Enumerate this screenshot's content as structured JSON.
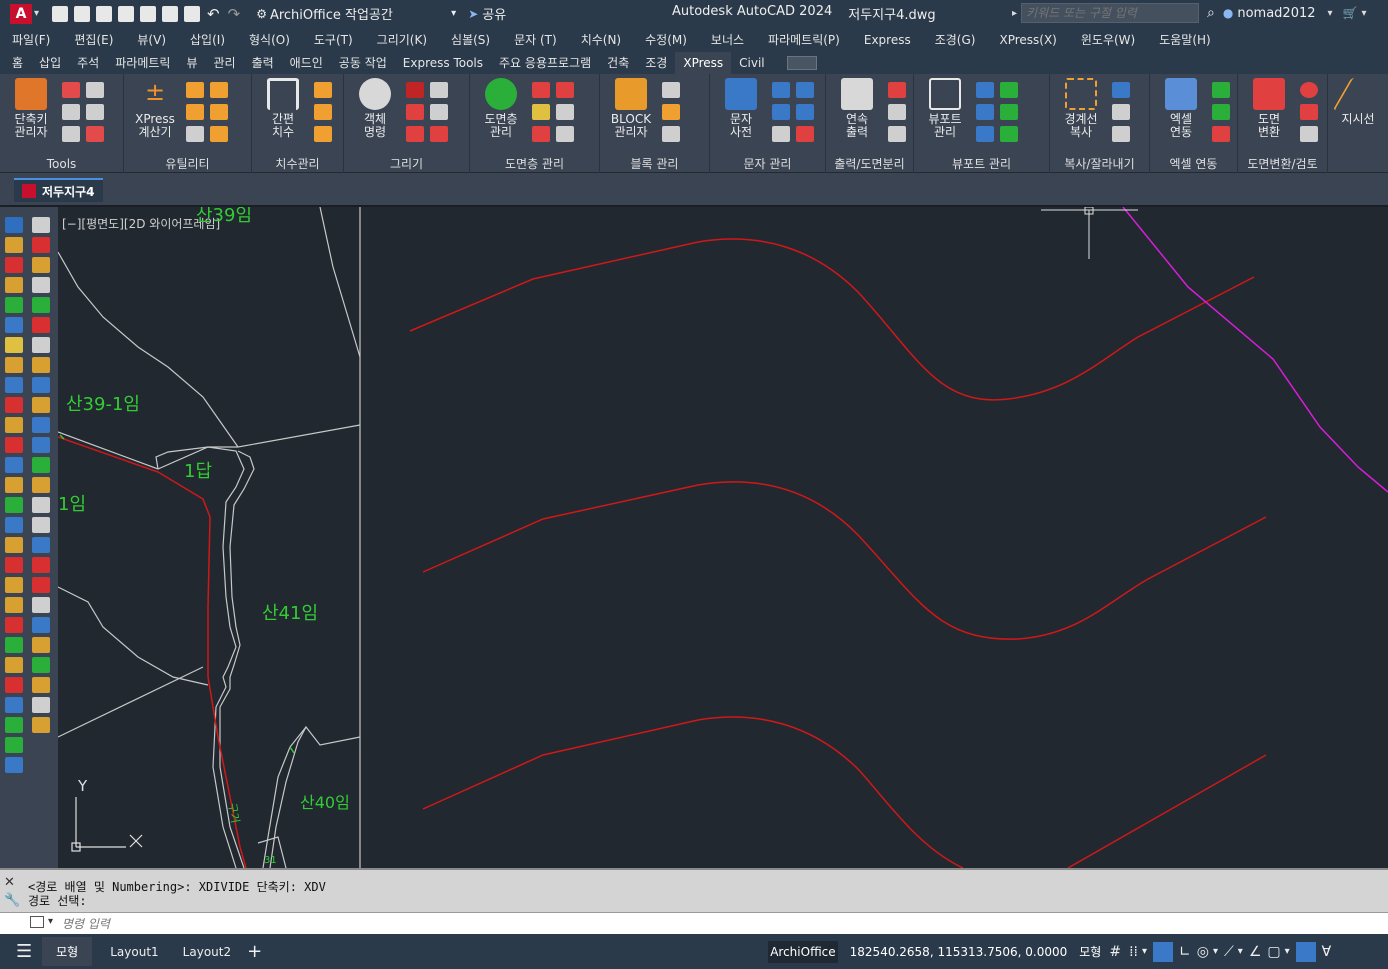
{
  "title": {
    "app_icon": "A",
    "workspace": "ArchiOffice 작업공간",
    "share": "공유",
    "app_name": "Autodesk AutoCAD 2024",
    "file_name": "저두지구4.dwg",
    "search_placeholder": "키워드 또는 구절 입력",
    "user": "nomad2012"
  },
  "menu": [
    "파일(F)",
    "편집(E)",
    "뷰(V)",
    "삽입(I)",
    "형식(O)",
    "도구(T)",
    "그리기(K)",
    "심볼(S)",
    "문자 (T)",
    "치수(N)",
    "수정(M)",
    "보너스",
    "파라메트릭(P)",
    "Express",
    "조경(G)",
    "XPress(X)",
    "윈도우(W)",
    "도움말(H)"
  ],
  "ribbon_tabs": [
    "홈",
    "삽입",
    "주석",
    "파라메트릭",
    "뷰",
    "관리",
    "출력",
    "애드인",
    "공동 작업",
    "Express Tools",
    "주요 응용프로그램",
    "건축",
    "조경",
    "XPress",
    "Civil"
  ],
  "ribbon_active": "XPress",
  "panels": [
    {
      "title": "Tools",
      "buttons": [
        "단축키\n관리자"
      ]
    },
    {
      "title": "유틸리티",
      "buttons": [
        "XPress\n계산기"
      ]
    },
    {
      "title": "치수관리",
      "buttons": [
        "간편\n치수"
      ]
    },
    {
      "title": "그리기",
      "buttons": [
        "객체\n명령"
      ]
    },
    {
      "title": "도면층 관리",
      "buttons": [
        "도면층\n관리"
      ]
    },
    {
      "title": "블록 관리",
      "buttons": [
        "BLOCK\n관리자"
      ]
    },
    {
      "title": "문자 관리",
      "buttons": [
        "문자\n사전"
      ]
    },
    {
      "title": "출력/도면분리",
      "buttons": [
        "연속\n출력"
      ]
    },
    {
      "title": "뷰포트 관리",
      "buttons": [
        "뷰포트\n관리"
      ]
    },
    {
      "title": "복사/잘라내기",
      "buttons": [
        "경계선\n복사"
      ]
    },
    {
      "title": "엑셀 연동",
      "buttons": [
        "엑셀\n연동"
      ]
    },
    {
      "title": "도면변환/검토",
      "buttons": [
        "도면\n변환"
      ]
    },
    {
      "title": "",
      "buttons": [
        "지시선"
      ]
    }
  ],
  "file_tab": "저두지구4",
  "viewport_label": "[−][평면도][2D 와이어프레임]",
  "cad_labels": {
    "l1": "산39임",
    "l2": "산39-1임",
    "l3": "1답",
    "l4": "1임",
    "l5": "산41임",
    "l6": "산40임",
    "l7": "구거",
    "l8": "31",
    "axis_y": "Y"
  },
  "command": {
    "line1": "<경로 배열 및 Numbering>: XDIVIDE  단축키: XDV",
    "line2": "경로 선택:",
    "placeholder": "명령 입력"
  },
  "status": {
    "layout_tabs": [
      "모형",
      "Layout1",
      "Layout2"
    ],
    "app": "ArchiOffice",
    "coords": "182540.2658, 115313.7506, 0.0000",
    "model": "모형"
  },
  "colors": {
    "red_line": "#d11818",
    "magenta_line": "#d81ed8",
    "label_green": "#33cc33",
    "boundary": "#c8c8c8"
  }
}
